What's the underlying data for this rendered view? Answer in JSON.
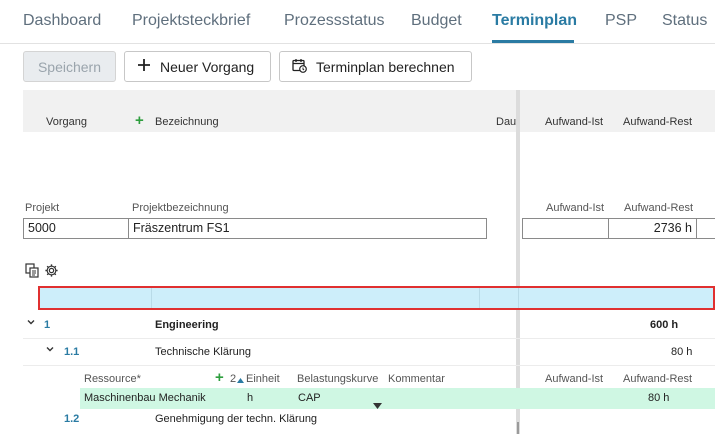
{
  "tabs": [
    {
      "label": "Dashboard",
      "active": false
    },
    {
      "label": "Projektsteckbrief",
      "active": false
    },
    {
      "label": "Prozessstatus",
      "active": false
    },
    {
      "label": "Budget",
      "active": false
    },
    {
      "label": "Terminplan",
      "active": true
    },
    {
      "label": "PSP",
      "active": false
    },
    {
      "label": "Status",
      "active": false
    }
  ],
  "toolbar": {
    "save_label": "Speichern",
    "new_task_label": "Neuer Vorgang",
    "calc_label": "Terminplan berechnen"
  },
  "grid": {
    "headers": {
      "vorgang": "Vorgang",
      "bezeichnung": "Bezeichnung",
      "dauer": "Dau",
      "aufwand_ist": "Aufwand-Ist",
      "aufwand_rest": "Aufwand-Rest"
    }
  },
  "project": {
    "label_projekt": "Projekt",
    "label_bezeichnung": "Projektbezeichnung",
    "label_aufwand_ist": "Aufwand-Ist",
    "label_aufwand_rest": "Aufwand-Rest",
    "projekt": "5000",
    "bezeichnung": "Fräszentrum FS1",
    "aufwand_ist": "",
    "aufwand_rest": "2736 h"
  },
  "rows": [
    {
      "num": "1",
      "name": "Engineering",
      "rest": "600 h",
      "bold": true
    },
    {
      "num": "1.1",
      "name": "Technische Klärung",
      "rest": "80 h",
      "bold": false
    },
    {
      "num": "1.2",
      "name": "Genehmigung der techn. Klärung",
      "rest": "",
      "bold": false
    }
  ],
  "resource": {
    "headers": {
      "ressource": "Ressource*",
      "count": "2",
      "einheit": "Einheit",
      "belastungskurve": "Belastungskurve",
      "kommentar": "Kommentar",
      "aufwand_ist": "Aufwand-Ist",
      "aufwand_rest": "Aufwand-Rest"
    },
    "row": {
      "name": "Maschinenbau Mechanik",
      "einheit": "h",
      "kurve": "CAP",
      "rest": "80 h"
    }
  },
  "colors": {
    "accent": "#2a7ba3",
    "selection_bg": "#cdeefa",
    "selection_border": "#e03030",
    "resource_bg": "#cff7e3",
    "add_green": "#2e9e3e"
  }
}
